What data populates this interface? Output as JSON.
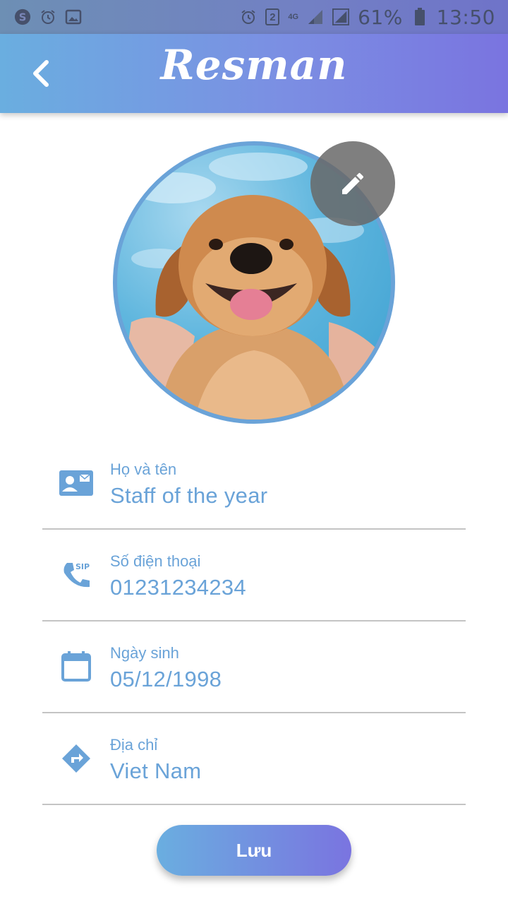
{
  "status_bar": {
    "battery_text": "61%",
    "time": "13:50",
    "sim_badge": "2",
    "network": "4G"
  },
  "app_bar": {
    "title": "Resman",
    "back_icon": "chevron-left-icon"
  },
  "profile": {
    "avatar": "puppy-photo",
    "edit_icon": "pencil-icon"
  },
  "fields": [
    {
      "icon": "contact-card-icon",
      "label": "Họ và tên",
      "value": "Staff of the year"
    },
    {
      "icon": "sip-phone-icon",
      "label": "Số điện thoại",
      "value": "01231234234"
    },
    {
      "icon": "calendar-icon",
      "label": "Ngày sinh",
      "value": "05/12/1998"
    },
    {
      "icon": "directions-icon",
      "label": "Địa chỉ",
      "value": "Viet Nam"
    }
  ],
  "save_label": "Lưu",
  "colors": {
    "accent": "#6aa3d8",
    "gradient_start": "#6aaee0",
    "gradient_end": "#7a74e0",
    "divider": "#c4c4c4"
  }
}
